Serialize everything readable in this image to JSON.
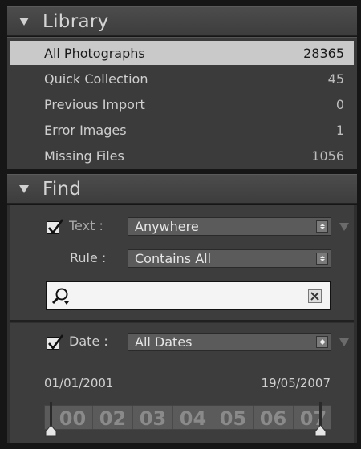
{
  "library": {
    "title": "Library",
    "items": [
      {
        "label": "All Photographs",
        "count": "28365",
        "selected": true
      },
      {
        "label": "Quick Collection",
        "count": "45",
        "selected": false
      },
      {
        "label": "Previous Import",
        "count": "0",
        "selected": false
      },
      {
        "label": "Error Images",
        "count": "1",
        "selected": false
      },
      {
        "label": "Missing Files",
        "count": "1056",
        "selected": false
      }
    ]
  },
  "find": {
    "title": "Find",
    "text_filter": {
      "label": "Text :",
      "checked": true,
      "scope_value": "Anywhere",
      "rule_label": "Rule :",
      "rule_value": "Contains All",
      "search_value": "",
      "search_placeholder": ""
    },
    "date_filter": {
      "label": "Date :",
      "checked": true,
      "value": "All Dates",
      "start_date": "01/01/2001",
      "end_date": "19/05/2007",
      "years": [
        "00",
        "02",
        "03",
        "04",
        "05",
        "06",
        "07"
      ]
    }
  },
  "colors": {
    "selected_row": "#c9c9c9",
    "panel_header": "#444444",
    "panel_body": "#3b3b3b",
    "select_bg": "#5b5b5b"
  }
}
